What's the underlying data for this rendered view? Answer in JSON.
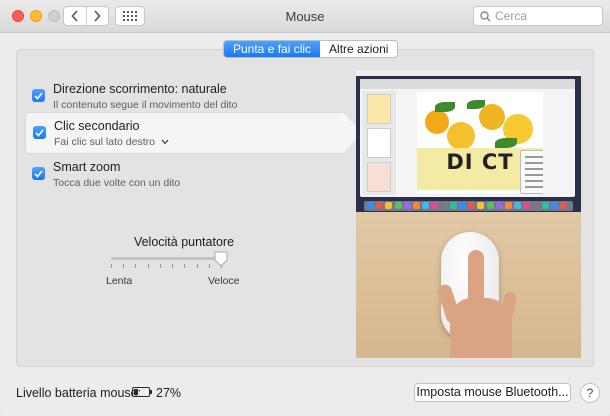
{
  "window": {
    "title": "Mouse"
  },
  "toolbar": {
    "search_placeholder": "Cerca"
  },
  "tabs": [
    {
      "label": "Punta e fai clic",
      "active": true
    },
    {
      "label": "Altre azioni",
      "active": false
    }
  ],
  "options": [
    {
      "title": "Direzione scorrimento: naturale",
      "subtitle": "Il contenuto segue il movimento del dito",
      "checked": true,
      "selected": false
    },
    {
      "title": "Clic secondario",
      "subtitle": "Fai clic sul lato destro",
      "checked": true,
      "selected": true,
      "has_dropdown": true
    },
    {
      "title": "Smart zoom",
      "subtitle": "Tocca due volte con un dito",
      "checked": true,
      "selected": false
    }
  ],
  "speed": {
    "label": "Velocità puntatore",
    "min_label": "Lenta",
    "max_label": "Veloce",
    "value": 1.0,
    "ticks": 10
  },
  "preview": {
    "document_word": "DI CT"
  },
  "footer": {
    "battery_label": "Livello batteria mouse:",
    "battery_percent": "27%",
    "battery_level": 0.27,
    "bluetooth_button": "Imposta mouse Bluetooth...",
    "help_label": "?"
  },
  "colors": {
    "accent": "#1a79f1",
    "panel": "#e3e3e3"
  },
  "icons": [
    "back-arrow-icon",
    "forward-arrow-icon",
    "grid-icon",
    "search-icon",
    "checkmark-icon",
    "chevron-down-icon",
    "battery-icon",
    "help-icon"
  ]
}
